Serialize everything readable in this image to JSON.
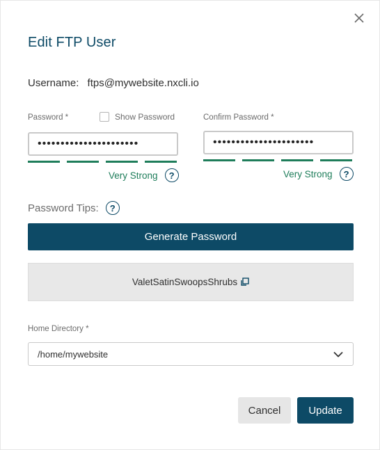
{
  "dialog": {
    "title": "Edit FTP User",
    "close_icon": "close-icon"
  },
  "username": {
    "label": "Username:",
    "value": "ftps@mywebsite.nxcli.io"
  },
  "password": {
    "label": "Password *",
    "show_password_label": "Show Password",
    "show_password_checked": false,
    "value": "••••••••••••••••••••••",
    "strength_text": "Very Strong",
    "strength_segments": 4,
    "strength_color": "#1e7d5a"
  },
  "confirm_password": {
    "label": "Confirm Password *",
    "value": "••••••••••••••••••••••",
    "strength_text": "Very Strong",
    "strength_segments": 4
  },
  "tips": {
    "label": "Password Tips:",
    "help_icon": "question-circle-icon"
  },
  "generate": {
    "button_label": "Generate Password",
    "generated_value": "ValetSatinSwoopsShrubs",
    "copy_icon": "copy-icon"
  },
  "home_directory": {
    "label": "Home Directory *",
    "selected": "/home/mywebsite",
    "chevron_icon": "chevron-down-icon"
  },
  "actions": {
    "cancel_label": "Cancel",
    "update_label": "Update"
  },
  "colors": {
    "primary": "#0d4a66",
    "success": "#1e7d5a",
    "muted_bg": "#e8e8e8"
  }
}
